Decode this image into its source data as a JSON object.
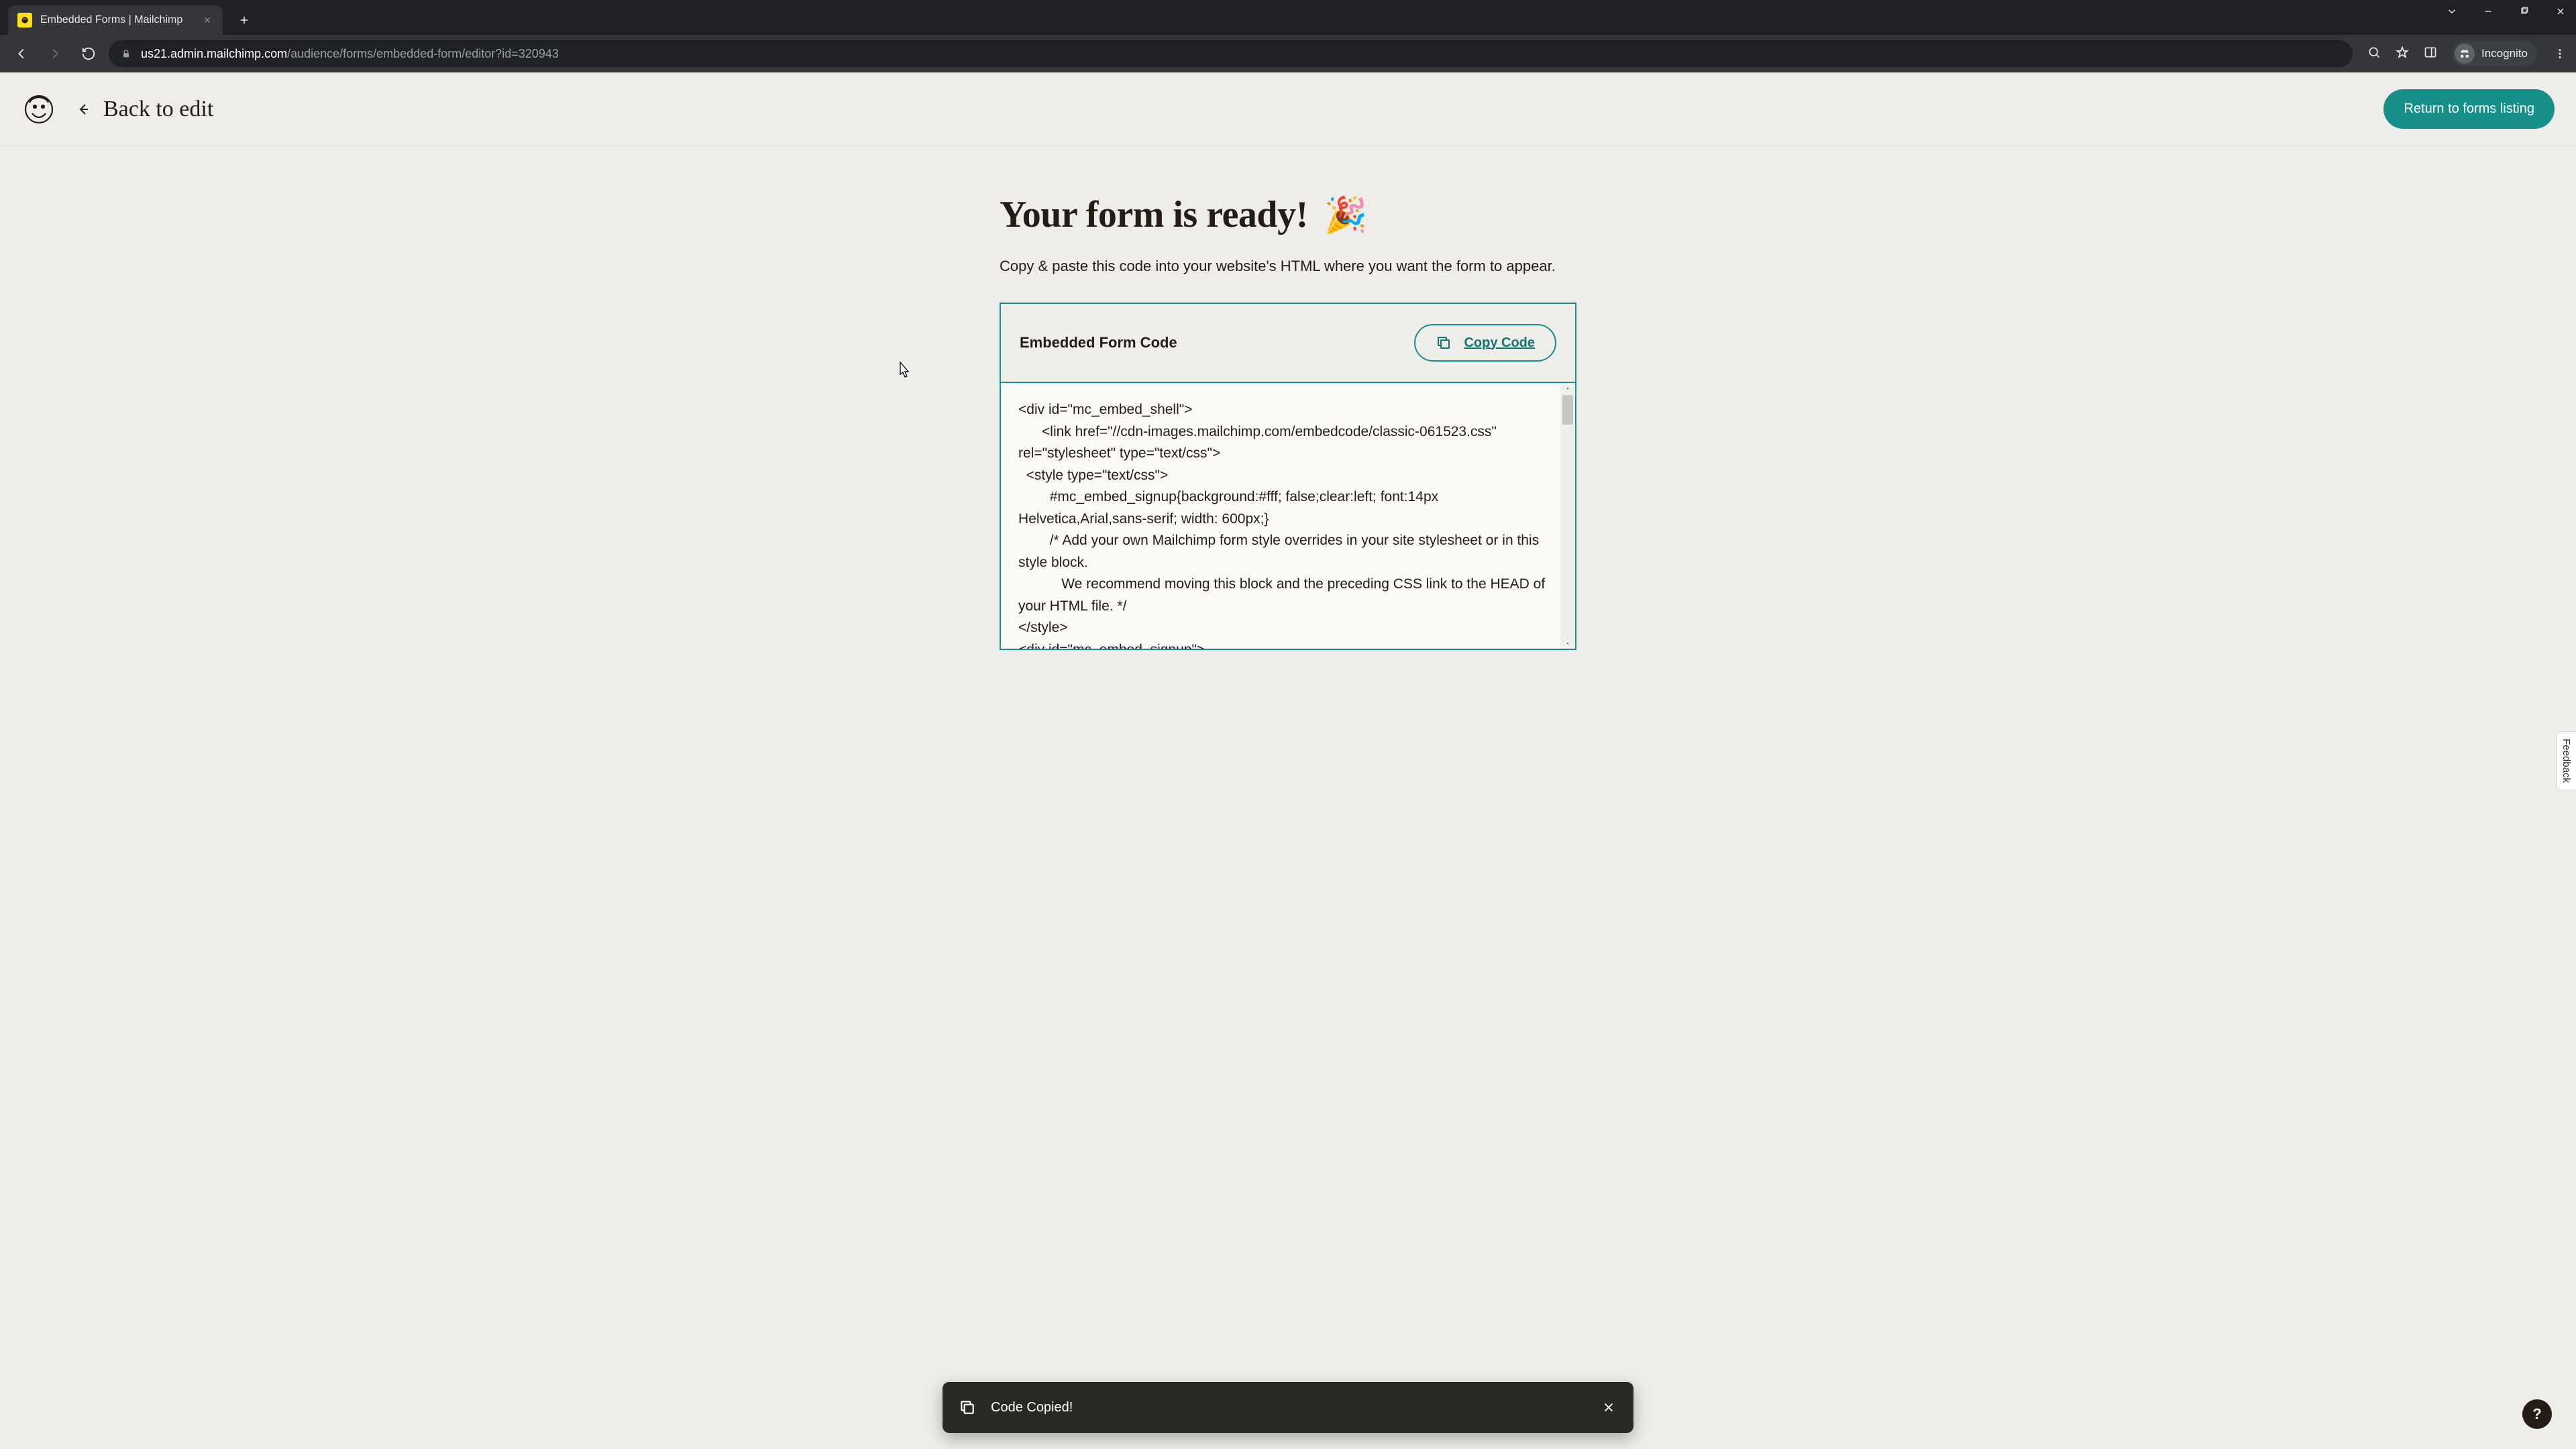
{
  "browser": {
    "tab_title": "Embedded Forms | Mailchimp",
    "url_host": "us21.admin.mailchimp.com",
    "url_path": "/audience/forms/embedded-form/editor?id=320943",
    "incognito_label": "Incognito"
  },
  "header": {
    "back_label": "Back to edit",
    "primary_button": "Return to forms listing"
  },
  "main": {
    "headline": "Your form is ready!",
    "confetti": "🎉",
    "subhead": "Copy & paste this code into your website's HTML where you want the form to appear.",
    "card_title": "Embedded Form Code",
    "copy_label": "Copy Code",
    "code_text": "<div id=\"mc_embed_shell\">\n      <link href=\"//cdn-images.mailchimp.com/embedcode/classic-061523.css\" rel=\"stylesheet\" type=\"text/css\">\n  <style type=\"text/css\">\n        #mc_embed_signup{background:#fff; false;clear:left; font:14px Helvetica,Arial,sans-serif; width: 600px;}\n        /* Add your own Mailchimp form style overrides in your site stylesheet or in this style block.\n           We recommend moving this block and the preceding CSS link to the HEAD of your HTML file. */\n</style>\n<div id=\"mc_embed_signup\">"
  },
  "toast": {
    "message": "Code Copied!"
  },
  "feedback_tab": "Feedback",
  "help_fab": "?",
  "colors": {
    "accent": "#168f89",
    "page_bg": "#eeedea",
    "text": "#241c15"
  }
}
